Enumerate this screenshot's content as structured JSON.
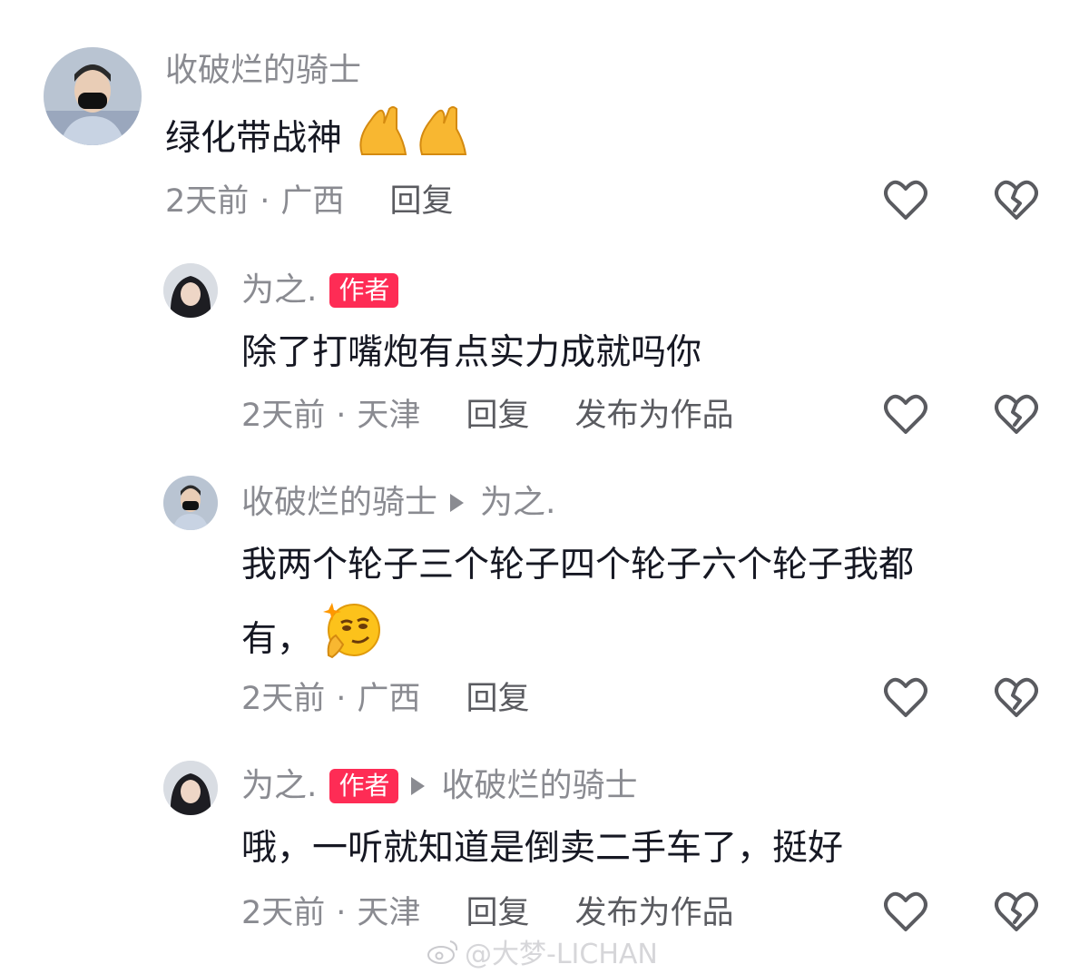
{
  "comments": [
    {
      "username": "收破烂的骑士",
      "text": "绿化带战神",
      "emoji": "pray-hands-emoji",
      "time": "2天前",
      "location": "广西",
      "reply_label": "回复"
    },
    {
      "username": "为之.",
      "badge": "作者",
      "text": "除了打嘴炮有点实力成就吗你",
      "time": "2天前",
      "location": "天津",
      "reply_label": "回复",
      "publish_label": "发布为作品"
    },
    {
      "username": "收破烂的骑士",
      "reply_to": "为之.",
      "text_line1": "我两个轮子三个轮子四个轮子六个轮子我都",
      "text_line2": "有，",
      "emoji": "smirk-thinking-emoji",
      "time": "2天前",
      "location": "广西",
      "reply_label": "回复"
    },
    {
      "username": "为之.",
      "badge": "作者",
      "reply_to": "收破烂的骑士",
      "text": "哦，一听就知道是倒卖二手车了，挺好",
      "time": "2天前",
      "location": "天津",
      "reply_label": "回复",
      "publish_label": "发布为作品"
    }
  ],
  "watermark": "@大梦-LICHAN",
  "icons": {
    "like": "heart-outline-icon",
    "dislike": "broken-heart-outline-icon"
  },
  "colors": {
    "badge": "#fe2c55",
    "meta": "#8a8b91",
    "text": "#161823"
  }
}
